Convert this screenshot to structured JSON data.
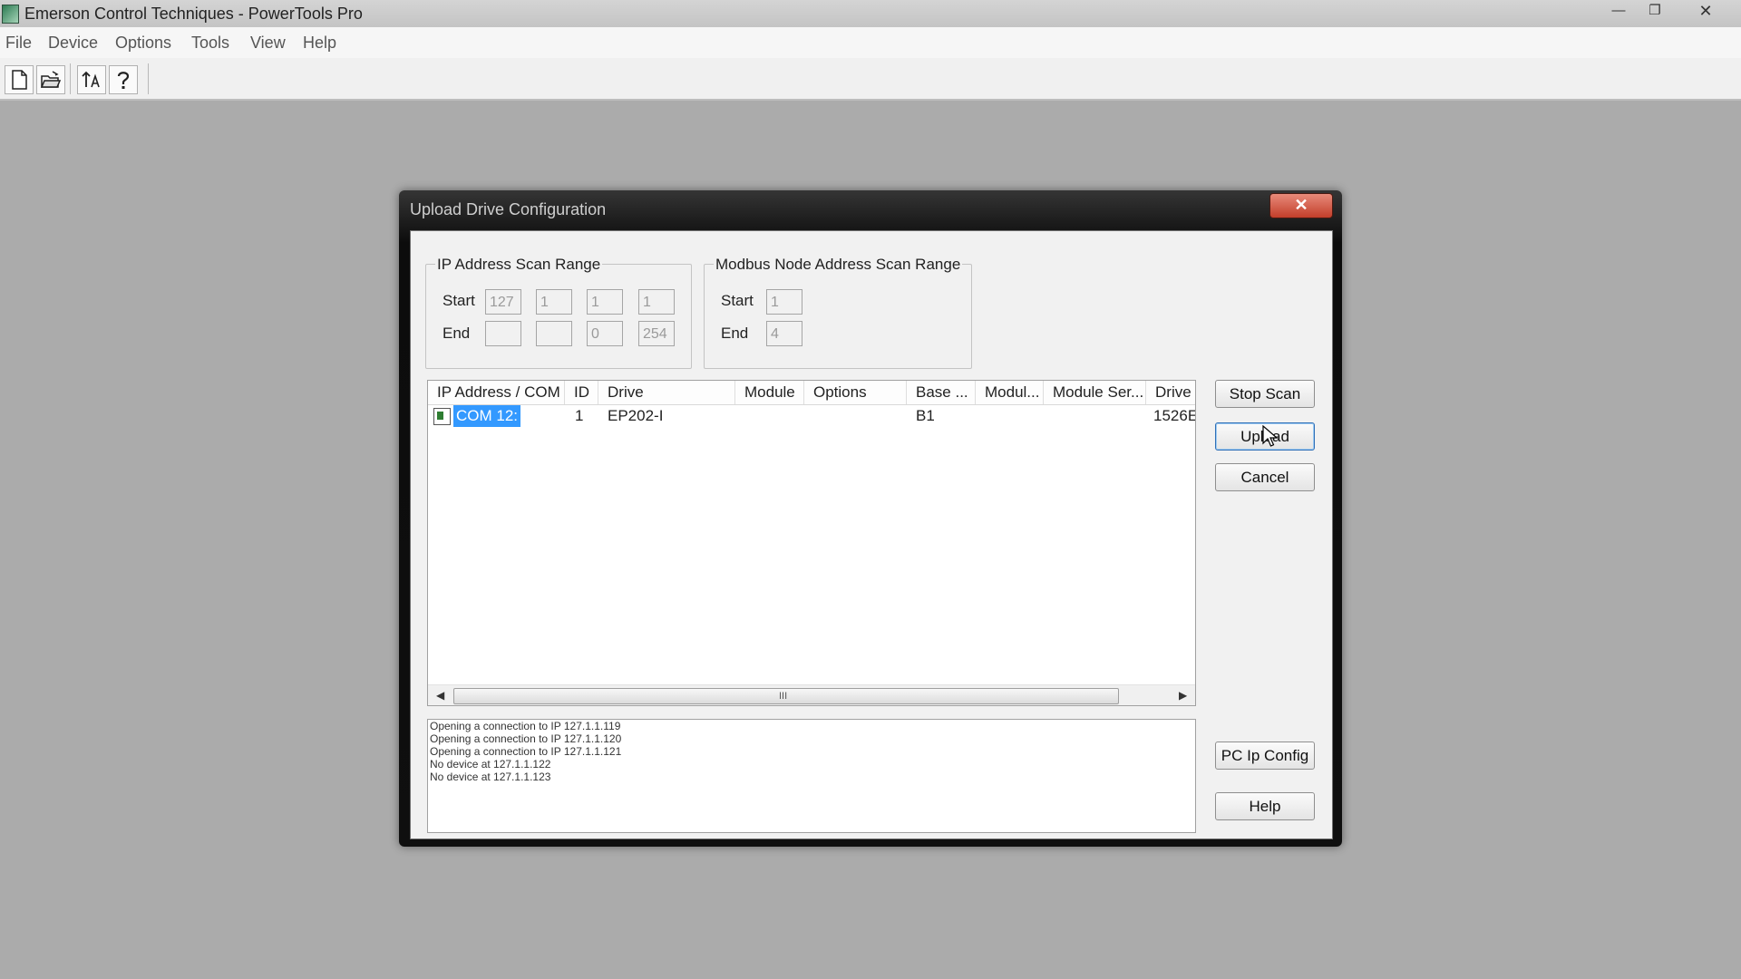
{
  "app": {
    "title": "Emerson Control Techniques - PowerTools Pro",
    "window_controls": {
      "minimize": "—",
      "maximize": "❐",
      "close": "✕"
    }
  },
  "menu": [
    "File",
    "Device",
    "Options",
    "Tools",
    "View",
    "Help"
  ],
  "toolbar": {
    "icons": [
      "new-file-icon",
      "open-folder-icon",
      "upload-icon",
      "help-icon"
    ]
  },
  "dialog": {
    "title": "Upload Drive Configuration",
    "close_glyph": "✕",
    "ip_scan": {
      "title": "IP Address Scan Range",
      "start_label": "Start",
      "end_label": "End",
      "start": [
        "127",
        "1",
        "1",
        "1"
      ],
      "end": [
        "",
        "",
        "0",
        "254"
      ]
    },
    "modbus_scan": {
      "title": "Modbus Node Address Scan Range",
      "start_label": "Start",
      "end_label": "End",
      "start": "1",
      "end": "4"
    },
    "list": {
      "columns": [
        "IP Address / COM",
        "ID",
        "Drive",
        "Module",
        "Options",
        "Base ...",
        "Modul...",
        "Module Ser...",
        "Drive"
      ],
      "rows": [
        {
          "address": "COM 12:",
          "id": "1",
          "drive": "EP202-I",
          "module": "",
          "options": "",
          "base": "B1",
          "modul": "",
          "module_ser": "",
          "drive_serial": "1526E"
        }
      ],
      "scroll_grip": "III"
    },
    "log": [
      "Opening a connection to IP 127.1.1.119",
      "Opening a connection to IP 127.1.1.120",
      "Opening a connection to IP 127.1.1.121",
      "No device at 127.1.1.122",
      "No device at 127.1.1.123"
    ],
    "buttons": {
      "stop_scan": "Stop Scan",
      "upload": "Upload",
      "cancel": "Cancel",
      "pc_ip_config": "PC Ip Config",
      "help": "Help"
    }
  }
}
